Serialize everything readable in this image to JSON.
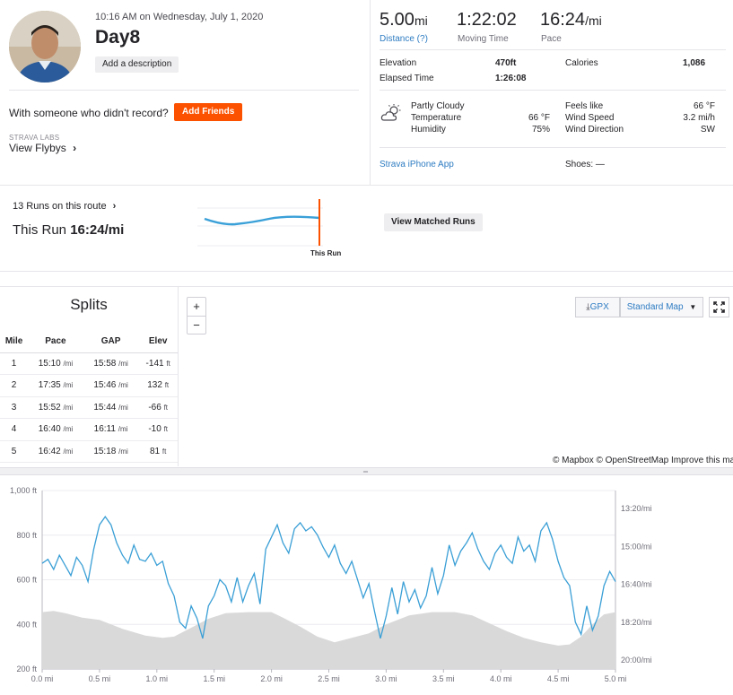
{
  "activity": {
    "date_time": "10:16 AM on Wednesday, July 1, 2020",
    "title": "Day8",
    "add_description": "Add a description",
    "with_someone": "With someone who didn't record?",
    "add_friends": "Add Friends",
    "labs_tag": "STRAVA LABS",
    "view_flybys": "View Flybys"
  },
  "stats": {
    "distance": {
      "value": "5.00",
      "unit": "mi",
      "label": "Distance (?)"
    },
    "moving_time": {
      "value": "1:22:02",
      "label": "Moving Time"
    },
    "pace": {
      "value": "16:24",
      "unit": "/mi",
      "label": "Pace"
    },
    "elevation": {
      "label": "Elevation",
      "value": "470ft"
    },
    "elapsed": {
      "label": "Elapsed Time",
      "value": "1:26:08"
    },
    "calories": {
      "label": "Calories",
      "value": "1,086"
    }
  },
  "weather": {
    "condition": "Partly Cloudy",
    "temperature_label": "Temperature",
    "temperature": "66 °F",
    "humidity_label": "Humidity",
    "humidity": "75%",
    "feels_label": "Feels like",
    "feels": "66 °F",
    "wind_speed_label": "Wind Speed",
    "wind_speed": "3.2 mi/h",
    "wind_dir_label": "Wind Direction",
    "wind_dir": "SW",
    "icon": "partly-cloudy-icon"
  },
  "device": {
    "app": "Strava iPhone App",
    "shoes": "Shoes: —"
  },
  "route": {
    "runs_on_route": "13 Runs on this route",
    "this_run_label": "This Run",
    "this_run_pace": "16:24/mi",
    "marker_label": "This Run",
    "view_matched": "View Matched Runs"
  },
  "splits": {
    "title": "Splits",
    "headers": [
      "Mile",
      "Pace",
      "GAP",
      "Elev"
    ],
    "rows": [
      {
        "mile": "1",
        "pace": "15:10",
        "gap": "15:58",
        "elev": "-141"
      },
      {
        "mile": "2",
        "pace": "17:35",
        "gap": "15:46",
        "elev": "132"
      },
      {
        "mile": "3",
        "pace": "15:52",
        "gap": "15:44",
        "elev": "-66"
      },
      {
        "mile": "4",
        "pace": "16:40",
        "gap": "16:11",
        "elev": "-10"
      },
      {
        "mile": "5",
        "pace": "16:42",
        "gap": "15:18",
        "elev": "81"
      }
    ],
    "pace_unit": "/mi",
    "elev_unit": "ft"
  },
  "map": {
    "zoom_in": "+",
    "zoom_out": "−",
    "gpx": "GPX",
    "map_style": "Standard Map",
    "attribution": "© Mapbox © OpenStreetMap Improve this map"
  },
  "chart_data": {
    "type": "line",
    "x_ticks": [
      "0.0 mi",
      "0.5 mi",
      "1.0 mi",
      "1.5 mi",
      "2.0 mi",
      "2.5 mi",
      "3.0 mi",
      "3.5 mi",
      "4.0 mi",
      "4.5 mi",
      "5.0 mi"
    ],
    "y_left_ticks": [
      "1,000 ft",
      "800 ft",
      "600 ft",
      "400 ft",
      "200 ft"
    ],
    "y_right_ticks": [
      "13:20/mi",
      "15:00/mi",
      "16:40/mi",
      "18:20/mi",
      "20:00/mi"
    ],
    "xlim": [
      0,
      5
    ],
    "elev_ylim": [
      200,
      1000
    ],
    "elevation": {
      "x": [
        0,
        0.1,
        0.2,
        0.35,
        0.5,
        0.7,
        0.9,
        1.05,
        1.15,
        1.3,
        1.45,
        1.6,
        1.8,
        2.0,
        2.1,
        2.25,
        2.4,
        2.55,
        2.7,
        2.85,
        3.0,
        3.2,
        3.4,
        3.6,
        3.75,
        3.9,
        4.05,
        4.2,
        4.35,
        4.5,
        4.6,
        4.7,
        4.8,
        4.9,
        5.0
      ],
      "y": [
        455,
        460,
        450,
        430,
        420,
        380,
        350,
        340,
        345,
        385,
        425,
        450,
        455,
        455,
        430,
        390,
        345,
        320,
        340,
        360,
        400,
        440,
        455,
        455,
        440,
        405,
        370,
        340,
        320,
        305,
        310,
        345,
        400,
        445,
        455
      ]
    },
    "pace_range_min_per_mi": [
      13.33,
      20.0
    ],
    "pace": {
      "x": [
        0,
        0.05,
        0.1,
        0.15,
        0.2,
        0.25,
        0.3,
        0.35,
        0.4,
        0.45,
        0.5,
        0.55,
        0.6,
        0.65,
        0.7,
        0.75,
        0.8,
        0.85,
        0.9,
        0.95,
        1.0,
        1.05,
        1.1,
        1.15,
        1.2,
        1.25,
        1.3,
        1.35,
        1.4,
        1.45,
        1.5,
        1.55,
        1.6,
        1.65,
        1.7,
        1.75,
        1.8,
        1.85,
        1.9,
        1.95,
        2.0,
        2.05,
        2.1,
        2.15,
        2.2,
        2.25,
        2.3,
        2.35,
        2.4,
        2.45,
        2.5,
        2.55,
        2.6,
        2.65,
        2.7,
        2.75,
        2.8,
        2.85,
        2.9,
        2.95,
        3.0,
        3.05,
        3.1,
        3.15,
        3.2,
        3.25,
        3.3,
        3.35,
        3.4,
        3.45,
        3.5,
        3.55,
        3.6,
        3.65,
        3.7,
        3.75,
        3.8,
        3.85,
        3.9,
        3.95,
        4.0,
        4.05,
        4.1,
        4.15,
        4.2,
        4.25,
        4.3,
        4.35,
        4.4,
        4.45,
        4.5,
        4.55,
        4.6,
        4.65,
        4.7,
        4.75,
        4.8,
        4.85,
        4.9,
        4.95,
        5.0
      ],
      "y": [
        15.9,
        15.7,
        16.2,
        15.5,
        16.0,
        16.5,
        15.6,
        16.0,
        16.8,
        15.2,
        14.0,
        13.6,
        14.0,
        14.9,
        15.5,
        15.9,
        15.0,
        15.7,
        15.8,
        15.4,
        16.0,
        15.8,
        16.9,
        17.5,
        18.8,
        19.1,
        18.0,
        18.6,
        19.6,
        18.0,
        17.5,
        16.7,
        17.0,
        17.8,
        16.6,
        17.8,
        17.0,
        16.4,
        17.9,
        15.2,
        14.6,
        14.0,
        14.9,
        15.4,
        14.2,
        13.9,
        14.3,
        14.1,
        14.5,
        15.1,
        15.6,
        15.0,
        15.9,
        16.4,
        15.8,
        16.7,
        17.6,
        16.9,
        18.3,
        19.6,
        18.5,
        17.1,
        18.4,
        16.8,
        17.8,
        17.2,
        18.1,
        17.5,
        16.1,
        17.4,
        16.5,
        15.0,
        16.0,
        15.3,
        14.9,
        14.4,
        15.2,
        15.8,
        16.2,
        15.4,
        15.0,
        15.6,
        15.9,
        14.6,
        15.3,
        15.0,
        15.8,
        14.3,
        13.9,
        14.7,
        15.8,
        16.6,
        17.0,
        18.8,
        19.4,
        18.0,
        19.2,
        18.5,
        17.0,
        16.3,
        16.8
      ]
    }
  }
}
